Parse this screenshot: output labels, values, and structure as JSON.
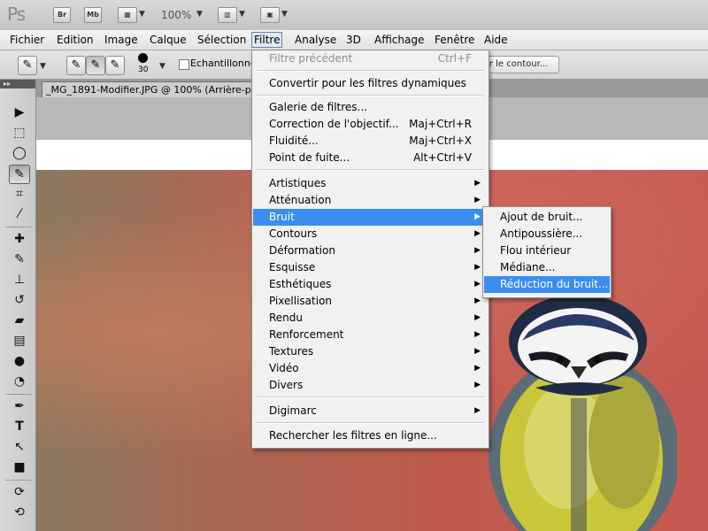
{
  "appbar": {
    "logo": "Ps",
    "bridge": "Br",
    "minibridge": "Mb",
    "zoom": "100%"
  },
  "menubar": [
    "Fichier",
    "Edition",
    "Image",
    "Calque",
    "Sélection",
    "Filtre",
    "Analyse",
    "3D",
    "Affichage",
    "Fenêtre",
    "Aide"
  ],
  "options": {
    "brush_size": "30",
    "sample_label": "Echantillonner",
    "contour_button": "er le contour..."
  },
  "document": {
    "tab_title": "_MG_1891-Modifier.JPG @ 100% (Arrière-pla"
  },
  "filter_menu": {
    "last_filter": {
      "label": "Filtre précédent",
      "shortcut": "Ctrl+F"
    },
    "smart": "Convertir pour les filtres dynamiques",
    "group1": [
      {
        "label": "Galerie de filtres...",
        "shortcut": ""
      },
      {
        "label": "Correction de l'objectif...",
        "shortcut": "Maj+Ctrl+R"
      },
      {
        "label": "Fluidité...",
        "shortcut": "Maj+Ctrl+X"
      },
      {
        "label": "Point de fuite...",
        "shortcut": "Alt+Ctrl+V"
      }
    ],
    "group2": [
      "Artistiques",
      "Atténuation",
      "Bruit",
      "Contours",
      "Déformation",
      "Esquisse",
      "Esthétiques",
      "Pixellisation",
      "Rendu",
      "Renforcement",
      "Textures",
      "Vidéo",
      "Divers"
    ],
    "digimarc": "Digimarc",
    "online": "Rechercher les filtres en ligne..."
  },
  "noise_submenu": [
    "Ajout de bruit...",
    "Antipoussière...",
    "Flou intérieur",
    "Médiane...",
    "Réduction du bruit..."
  ],
  "colors": {
    "highlight": "#3a8ef0",
    "menu_bg": "#f1f1f1"
  }
}
